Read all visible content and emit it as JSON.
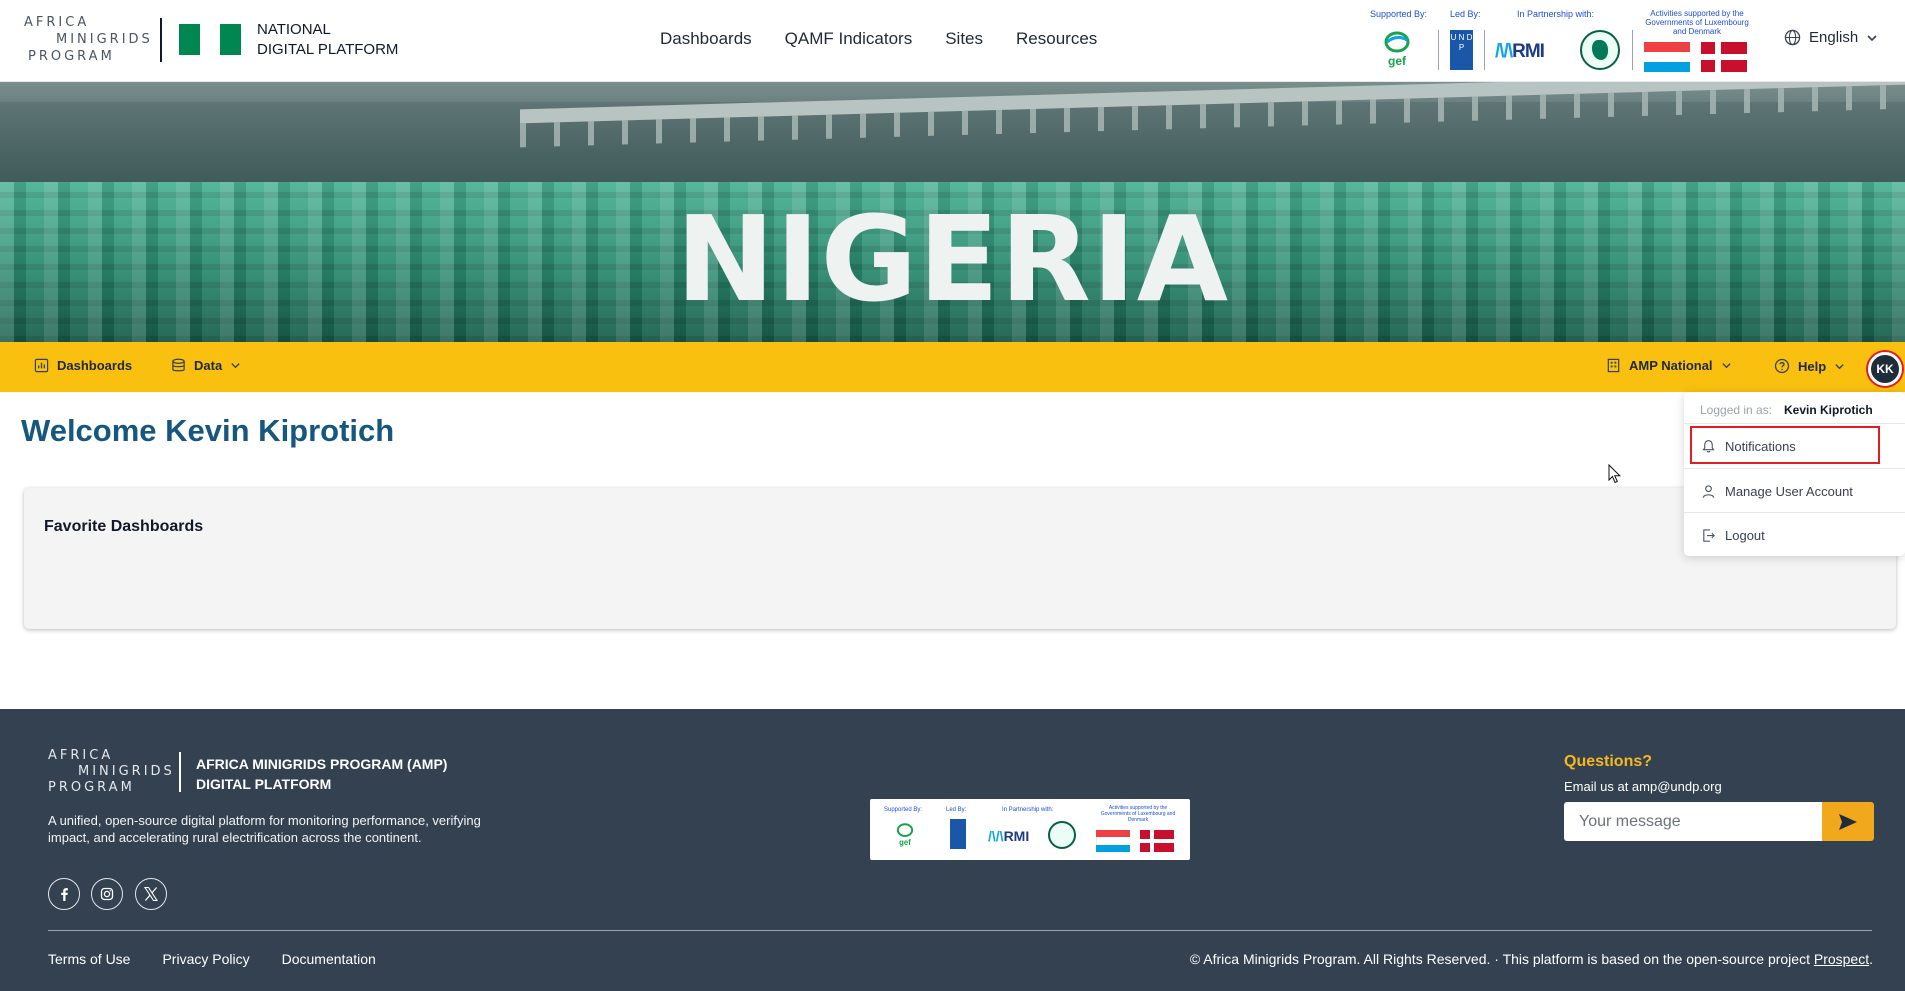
{
  "header": {
    "logo_lines": [
      "AFRICA",
      "MINIGRIDS",
      "PROGRAM"
    ],
    "platform_title_line1": "NATIONAL",
    "platform_title_line2": "DIGITAL PLATFORM",
    "nav": [
      "Dashboards",
      "QAMF Indicators",
      "Sites",
      "Resources"
    ],
    "partners": {
      "supported_by": "Supported By:",
      "led_by": "Led By:",
      "in_partnership": "In Partnership with:",
      "activities": "Activities supported by the Governments of Luxembourg and Denmark",
      "gef": "gef",
      "undp": "U N D P",
      "rmi": "RMI"
    },
    "language": "English"
  },
  "hero": {
    "title": "NIGERIA"
  },
  "subnav": {
    "dashboards": "Dashboards",
    "data": "Data",
    "amp_national": "AMP National",
    "help": "Help",
    "avatar_initials": "KK"
  },
  "main": {
    "welcome": "Welcome Kevin Kiprotich",
    "favorite_title": "Favorite Dashboards"
  },
  "user_menu": {
    "logged_in_label": "Logged in as:",
    "user_name": "Kevin Kiprotich",
    "items": [
      "Notifications",
      "Manage User Account",
      "Logout"
    ]
  },
  "footer": {
    "logo_lines": [
      "AFRICA",
      "MINIGRIDS",
      "PROGRAM"
    ],
    "title_line1": "AFRICA MINIGRIDS PROGRAM (AMP)",
    "title_line2": "DIGITAL PLATFORM",
    "description": "A unified, open-source digital platform for monitoring performance, verifying impact, and accelerating rural electrification across the continent.",
    "questions": "Questions?",
    "email": "Email us at amp@undp.org",
    "message_placeholder": "Your message",
    "links": [
      "Terms of Use",
      "Privacy Policy",
      "Documentation"
    ],
    "copyright": "© Africa Minigrids Program. All Rights Reserved.  ·  This platform is based on the open-source project",
    "prospect_link": "Prospect",
    "period": "."
  },
  "colors": {
    "brand_blue": "#15577f",
    "subnav_yellow": "#f9c00f",
    "footer_bg": "#334150",
    "accent_orange": "#f2a81d",
    "highlight_red": "#e11d24"
  }
}
